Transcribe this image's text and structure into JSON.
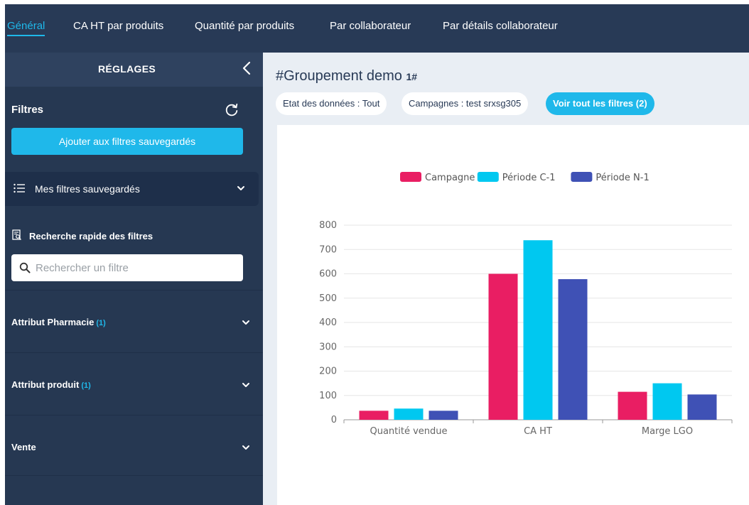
{
  "nav": {
    "tabs": [
      {
        "label": "Général",
        "active": true
      },
      {
        "label": "CA HT par produits",
        "active": false
      },
      {
        "label": "Quantité par produits",
        "active": false
      },
      {
        "label": "Par collaborateur",
        "active": false
      },
      {
        "label": "Par détails collaborateur",
        "active": false
      }
    ]
  },
  "sidebar": {
    "title": "RÉGLAGES",
    "collapse_icon": "chevron-left-icon",
    "filters_label": "Filtres",
    "refresh_icon": "refresh-icon",
    "add_button": "Ajouter aux filtres sauvegardés",
    "saved_filters": "Mes filtres sauvegardés",
    "quick_search_label": "Recherche rapide des filtres",
    "search_placeholder": "Rechercher un filtre",
    "sections": [
      {
        "label": "Attribut Pharmacie",
        "count": "(1)"
      },
      {
        "label": "Attribut produit",
        "count": "(1)"
      },
      {
        "label": "Vente",
        "count": ""
      }
    ]
  },
  "main": {
    "title": "#Groupement demo",
    "title_suffix": "1#",
    "chips": [
      {
        "label": "Etat des données : Tout"
      },
      {
        "label": "Campagnes : test srxsg305"
      },
      {
        "label": "Voir tout les filtres (2)"
      }
    ]
  },
  "colors": {
    "accent": "#1fb8ea",
    "navy": "#283a56",
    "campagne": "#e91e63",
    "periode_c1": "#00c8f0",
    "periode_n1": "#3f51b5"
  },
  "chart_data": {
    "type": "bar",
    "categories": [
      "Quantité vendue",
      "CA HT",
      "Marge LGO"
    ],
    "series": [
      {
        "name": "Campagne",
        "color": "#e91e63",
        "values": [
          37,
          600,
          115
        ]
      },
      {
        "name": "Période C-1",
        "color": "#00c8f0",
        "values": [
          46,
          738,
          150
        ]
      },
      {
        "name": "Période N-1",
        "color": "#3f51b5",
        "values": [
          37,
          578,
          104
        ]
      }
    ],
    "yticks": [
      0,
      100,
      200,
      300,
      400,
      500,
      600,
      700,
      800
    ],
    "ylim": [
      0,
      800
    ],
    "grid": true,
    "legend": "top-center"
  }
}
